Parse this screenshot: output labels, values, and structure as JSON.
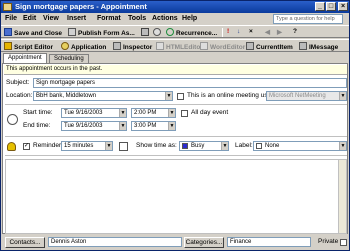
{
  "window": {
    "title": "Sign mortgage papers - Appointment",
    "min_glyph": "_",
    "max_glyph": "□",
    "close_glyph": "×"
  },
  "menu": {
    "items": [
      "File",
      "Edit",
      "View",
      "Insert",
      "Format",
      "Tools",
      "Actions",
      "Help"
    ],
    "help_placeholder": "Type a question for help"
  },
  "toolbar1": {
    "save_close": "Save and Close",
    "publish_form": "Publish Form As...",
    "recurrence": "Recurrence...",
    "close_glyph": "×"
  },
  "toolbar2": {
    "script_editor": "Script Editor",
    "application": "Application",
    "inspector": "Inspector",
    "html_editor": "HTMLEditor",
    "word_editor": "WordEditor",
    "current_item": "CurrentItem",
    "imessage": "IMessage"
  },
  "tabs": [
    "Appointment",
    "Scheduling"
  ],
  "info": "This appointment occurs in the past.",
  "subject": {
    "label": "Subject:",
    "value": "Sign mortgage papers"
  },
  "location": {
    "label": "Location:",
    "value": "BbH bank, Middletown",
    "online_label": "This is an online meeting using:",
    "online_value": "Microsoft NetMeeting"
  },
  "start": {
    "label": "Start time:",
    "date": "Tue 9/16/2003",
    "time": "2:00 PM",
    "all_day": "All day event"
  },
  "end": {
    "label": "End time:",
    "date": "Tue 9/16/2003",
    "time": "3:00 PM"
  },
  "reminder": {
    "label": "Reminder:",
    "value": "15 minutes",
    "showtime_label": "Show time as:",
    "showtime_value": "Busy",
    "label_label": "Label:",
    "label_value": "None"
  },
  "bottom": {
    "contacts_button": "Contacts...",
    "contacts_value": "Dennis Aston",
    "categories_button": "Categories...",
    "categories_value": "Finance",
    "private_label": "Private"
  },
  "colors": {
    "busy": "#2b2bd0",
    "titlebar": "#0a3a9c",
    "info_bg": "#ffffe1"
  }
}
